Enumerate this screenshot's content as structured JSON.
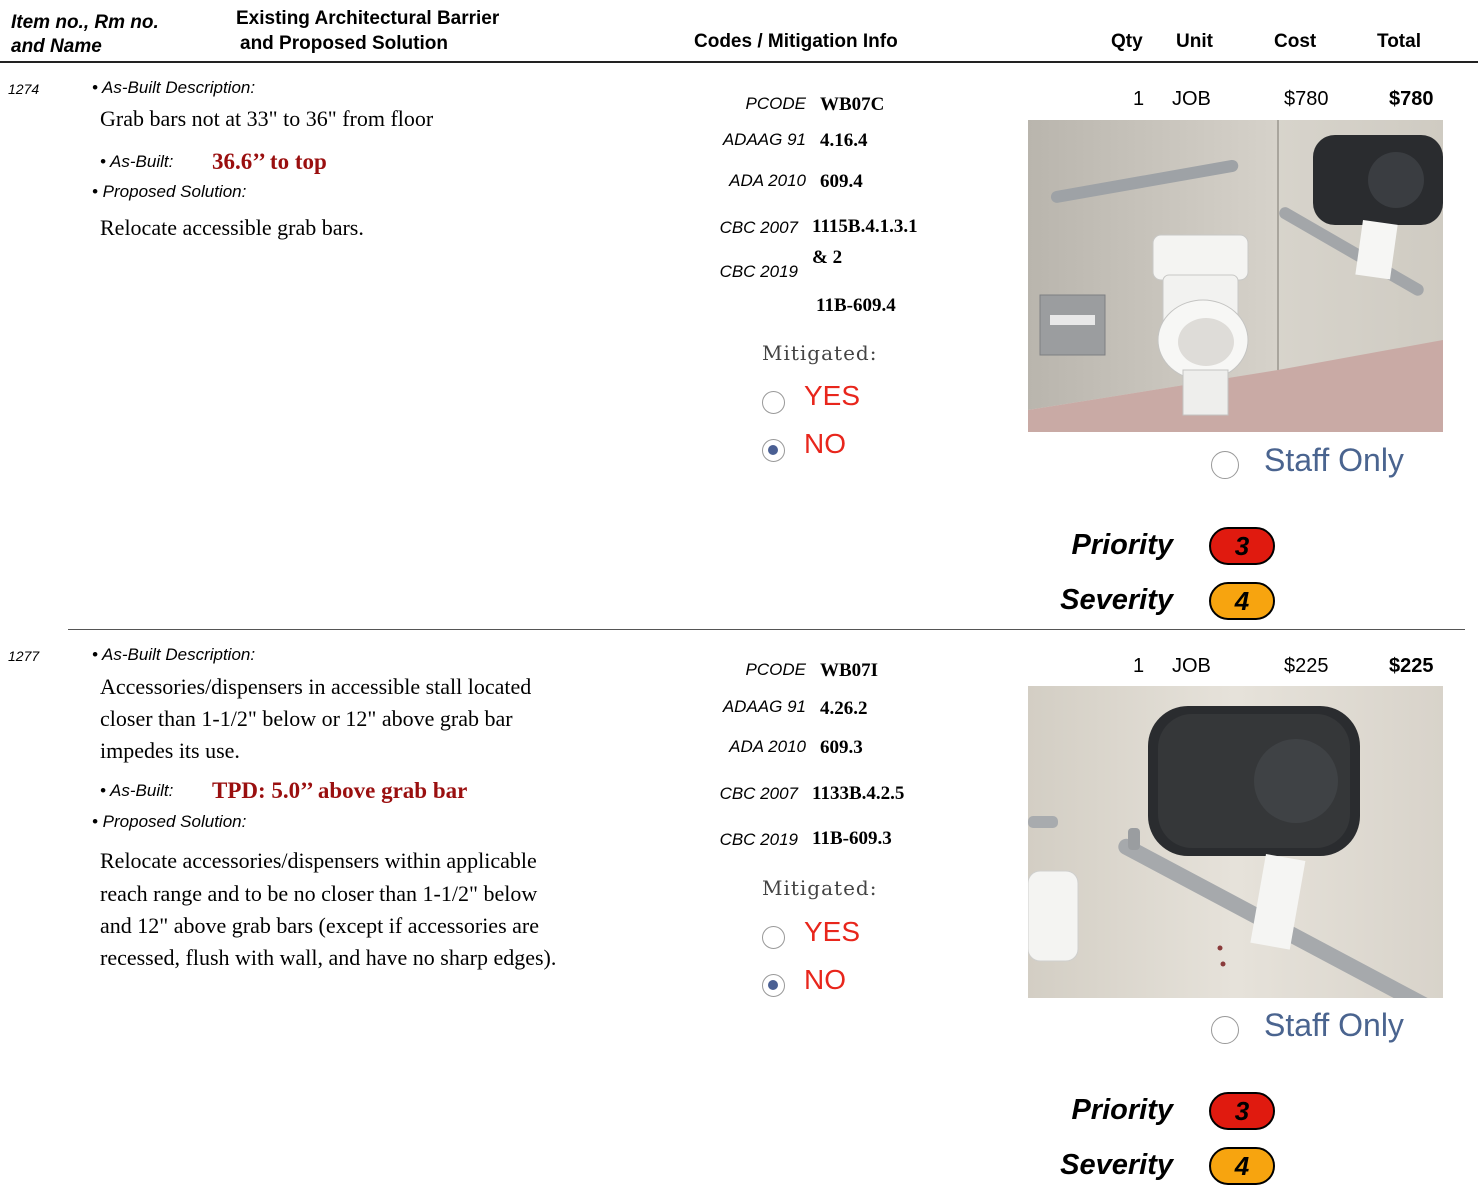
{
  "header": {
    "col_item_line1": "Item no., Rm no.",
    "col_item_line2": "and Name",
    "col_barrier_line1": "Existing Architectural Barrier",
    "col_barrier_line2": "and Proposed Solution",
    "col_codes": "Codes / Mitigation Info",
    "col_qty": "Qty",
    "col_unit": "Unit",
    "col_cost": "Cost",
    "col_total": "Total"
  },
  "colors": {
    "accent_red": "#9a0f0f",
    "priority": "#e01a0f",
    "severity": "#f7a40f",
    "radio_blue": "#4a5f93",
    "staff_text": "#4a648f"
  },
  "items": [
    {
      "item_no": "1274",
      "asbuilt_heading": "• As-Built Description:",
      "asbuilt_desc": "Grab bars not at 33\" to 36\" from floor",
      "asbuilt_label": "• As-Built:",
      "asbuilt_value": "36.6’’ to top",
      "proposed_heading": "• Proposed Solution:",
      "proposed_text": "Relocate accessible grab bars.",
      "codes": [
        {
          "label": "PCODE",
          "value": "WB07C"
        },
        {
          "label": "ADAAG 91",
          "value": "4.16.4"
        },
        {
          "label": "ADA 2010",
          "value": "609.4"
        },
        {
          "label": "CBC 2007",
          "value": "1115B.4.1.3.1"
        },
        {
          "label": "CBC 2019",
          "value": "& 2"
        }
      ],
      "code_extra": "11B-609.4",
      "mitigated_label": "Mitigated:",
      "yes_label": "YES",
      "no_label": "NO",
      "mitigated_selected": "NO",
      "qty": "1",
      "unit": "JOB",
      "cost": "$780",
      "total": "$780",
      "staff_only_label": "Staff Only",
      "staff_only_checked": false,
      "priority_label": "Priority",
      "priority": "3",
      "severity_label": "Severity",
      "severity": "4"
    },
    {
      "item_no": "1277",
      "asbuilt_heading": "• As-Built Description:",
      "asbuilt_desc_lines": [
        "Accessories/dispensers in accessible stall located",
        "closer than 1-1/2\" below or 12\" above grab bar",
        "impedes its use."
      ],
      "asbuilt_label": "• As-Built:",
      "asbuilt_value": "TPD: 5.0’’ above grab bar",
      "proposed_heading": "• Proposed Solution:",
      "proposed_lines": [
        "Relocate accessories/dispensers within applicable",
        "reach range and  to be no closer than 1-1/2\" below",
        "and 12\" above grab bars (except if accessories are",
        "recessed, flush with wall, and have no sharp edges)."
      ],
      "codes": [
        {
          "label": "PCODE",
          "value": "WB07I"
        },
        {
          "label": "ADAAG 91",
          "value": "4.26.2"
        },
        {
          "label": "ADA 2010",
          "value": "609.3"
        },
        {
          "label": "CBC 2007",
          "value": "1133B.4.2.5"
        },
        {
          "label": "CBC 2019",
          "value": "11B-609.3"
        }
      ],
      "mitigated_label": "Mitigated:",
      "yes_label": "YES",
      "no_label": "NO",
      "mitigated_selected": "NO",
      "qty": "1",
      "unit": "JOB",
      "cost": "$225",
      "total": "$225",
      "staff_only_label": "Staff Only",
      "staff_only_checked": false,
      "priority_label": "Priority",
      "priority": "3",
      "severity_label": "Severity",
      "severity": "4"
    }
  ]
}
